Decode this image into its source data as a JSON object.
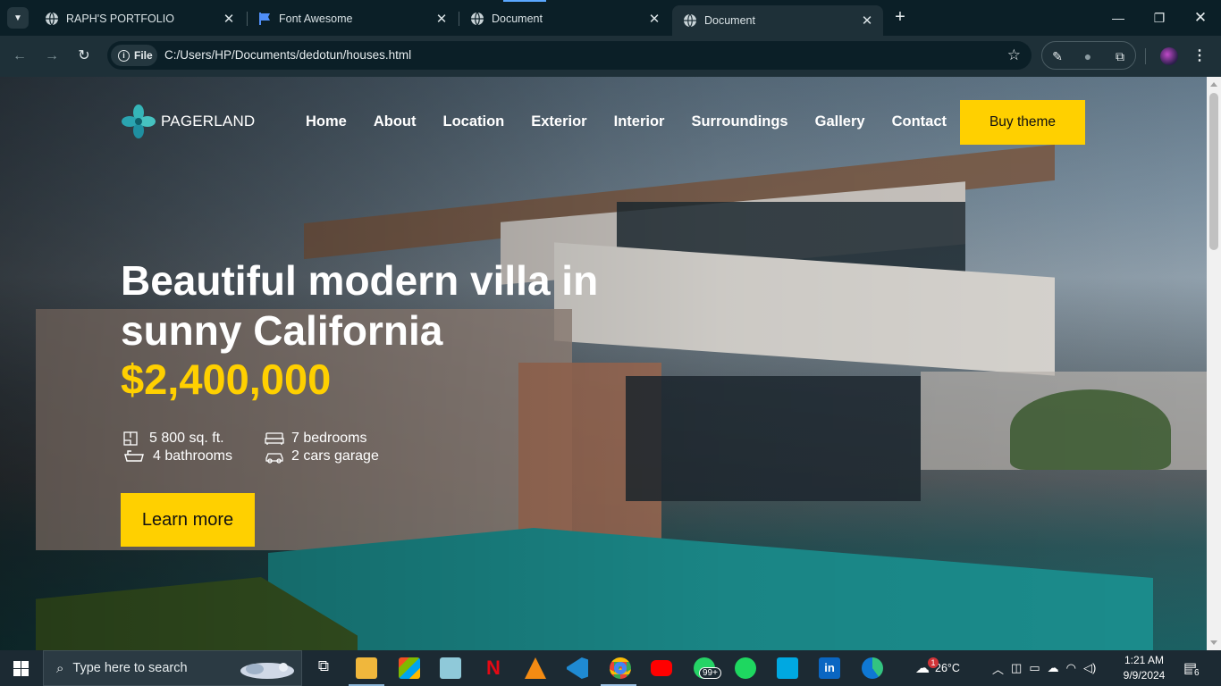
{
  "browser": {
    "tabs": [
      {
        "title": "RAPH'S PORTFOLIO",
        "icon": "globe-icon",
        "active": false
      },
      {
        "title": "Font Awesome",
        "icon": "flag-icon",
        "active": false
      },
      {
        "title": "Document",
        "icon": "globe-icon",
        "active": false
      },
      {
        "title": "Document",
        "icon": "globe-icon",
        "active": true
      }
    ],
    "address": {
      "scheme_chip": "File",
      "url": "C:/Users/HP/Documents/dedotun/houses.html"
    }
  },
  "site": {
    "logo_text": "PAGERLAND",
    "nav": [
      "Home",
      "About",
      "Location",
      "Exterior",
      "Interior",
      "Surroundings",
      "Gallery",
      "Contact"
    ],
    "buy_label": "Buy theme",
    "hero_title": "Beautiful modern villa in sunny California",
    "price": "$2,400,000",
    "features": {
      "area": "5 800 sq. ft.",
      "bedrooms": "7 bedrooms",
      "bathrooms": "4 bathrooms",
      "garage": "2 cars garage"
    },
    "cta_label": "Learn more",
    "accent_color": "#ffd000"
  },
  "taskbar": {
    "search_placeholder": "Type here to search",
    "whatsapp_badge": "99+",
    "weather": "26°C",
    "weather_badge": "1",
    "time": "1:21 AM",
    "date": "9/9/2024",
    "notifications": "6"
  }
}
